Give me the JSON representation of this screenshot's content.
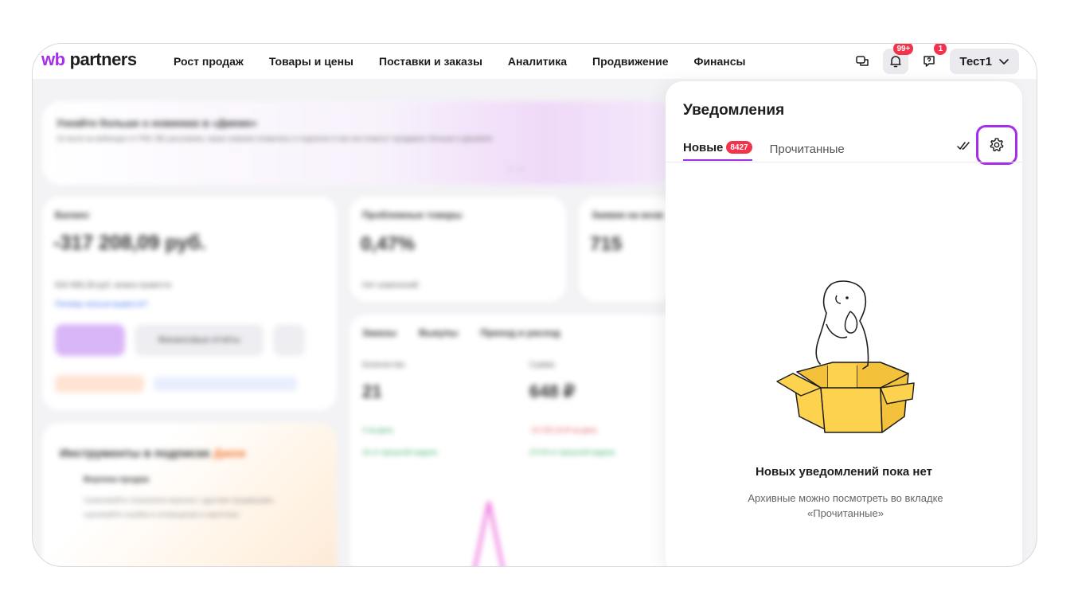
{
  "header": {
    "logo_wb": "wb",
    "logo_partners": "partners",
    "nav": [
      "Рост продаж",
      "Товары и цены",
      "Поставки и заказы",
      "Аналитика",
      "Продвижение",
      "Финансы"
    ],
    "notifications_badge": "99+",
    "help_badge": "1",
    "user_name": "Тест1"
  },
  "background": {
    "promo_title": "Узнайте больше о новинках в «Джеме»",
    "promo_text": "16 июля на вебинаре от РФС ВБ расскажем, какие новинки появились в подписке и как они помогут продавать больше и дешевле",
    "balance_label": "Баланс",
    "balance_value": "-317 208,09 руб.",
    "balance_sub": "934 686,39 руб. можно вывести",
    "balance_link": "Почему нельзя вывести?",
    "balance_btn_withdraw": "Вывести",
    "balance_btn_reports": "Финансовые отчёты",
    "problem_label": "Проблемные товары",
    "problem_value": "0,47%",
    "problem_sub": "Нет изменений",
    "requests_label": "Заявки на возв",
    "requests_value": "715",
    "orders_tabs": [
      "Заказы",
      "Выкупы",
      "Приход и расход"
    ],
    "orders_qty_label": "Количество",
    "orders_qty_value": "21",
    "orders_sum_label": "Сумма",
    "orders_sum_value": "648 ₽",
    "orders_g1": "3  за день",
    "orders_g2": "16  от прошлой недели",
    "orders_g3": "-10 222,16 ₽  за день",
    "orders_g4": "274 ₽  от прошлой недели",
    "tools_title": "Инструменты в подписке",
    "tools_brand": "Джем",
    "tools_item": "Воронка продаж",
    "tools_desc": "Сравнивайте показатели воронки с другими продавцами, оценивайте ошибки в оповещении и карточках"
  },
  "panel": {
    "title": "Уведомления",
    "tab_new": "Новые",
    "tab_new_count": "8427",
    "tab_read": "Прочитанные",
    "empty_title": "Новых уведомлений пока нет",
    "empty_desc": "Архивные можно посмотреть во вкладке «Прочитанные»"
  },
  "colors": {
    "accent": "#a52fe8",
    "badge": "#f2334b",
    "box": "#fdd24e"
  },
  "icons": {
    "chat": "chat-icon",
    "bell": "bell-icon",
    "help": "help-icon",
    "chevron": "chevron-down-icon",
    "read_all": "double-check-icon",
    "settings": "gear-icon"
  }
}
